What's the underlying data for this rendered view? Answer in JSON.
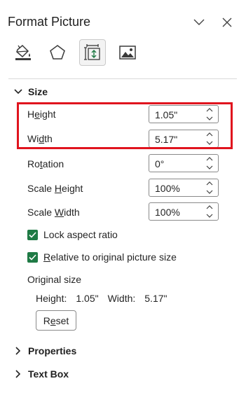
{
  "header": {
    "title": "Format Picture",
    "collapse_icon": "chevron-down-icon",
    "close_icon": "close-icon"
  },
  "tabs": [
    {
      "name": "fill-line",
      "icon": "paint-bucket-icon",
      "active": false
    },
    {
      "name": "effects",
      "icon": "pentagon-icon",
      "active": false
    },
    {
      "name": "size-properties",
      "icon": "size-position-icon",
      "active": true
    },
    {
      "name": "picture",
      "icon": "picture-icon",
      "active": false
    }
  ],
  "size_section": {
    "title": "Size",
    "expanded": true,
    "height": {
      "label": "Height",
      "value": "1.05\""
    },
    "width": {
      "label": "Width",
      "value": "5.17\""
    },
    "rotation": {
      "label": "Rotation",
      "value": "0°"
    },
    "scale_height": {
      "label": "Scale Height",
      "value": "100%"
    },
    "scale_width": {
      "label": "Scale Width",
      "value": "100%"
    },
    "lock_aspect": {
      "label": "Lock aspect ratio",
      "checked": true
    },
    "relative_original": {
      "label": "Relative to original picture size",
      "checked": true
    },
    "original_size": {
      "title": "Original size",
      "height_label": "Height:",
      "height_value": "1.05\"",
      "width_label": "Width:",
      "width_value": "5.17\""
    },
    "reset_label": "Reset"
  },
  "properties_section": {
    "title": "Properties",
    "expanded": false
  },
  "textbox_section": {
    "title": "Text Box",
    "expanded": false
  },
  "colors": {
    "accent": "#1f7a45",
    "highlight": "#e0141e",
    "border": "#8a8a8a"
  }
}
